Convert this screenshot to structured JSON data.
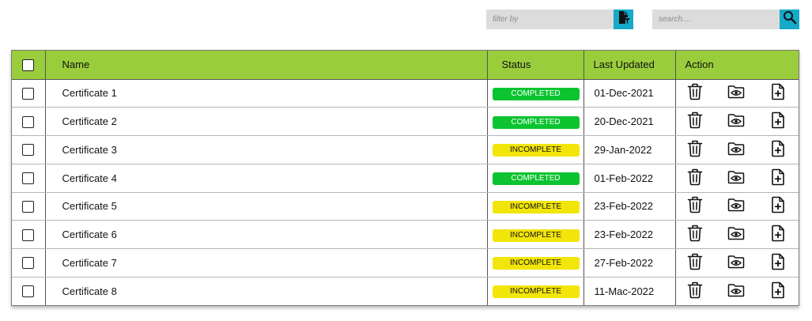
{
  "toolbar": {
    "filter_placeholder": "filter by",
    "search_placeholder": "search....",
    "accent_color": "#16a9c9"
  },
  "table": {
    "header_color": "#9acd3c",
    "columns": {
      "name": "Name",
      "status": "Status",
      "last_updated": "Last Updated",
      "action": "Action"
    },
    "status_colors": {
      "COMPLETED": "#0bc42f",
      "INCOMPLETE": "#f2e50b"
    },
    "rows": [
      {
        "name": "Certificate 1",
        "status": "COMPLETED",
        "date": "01-Dec-2021"
      },
      {
        "name": "Certificate 2",
        "status": "COMPLETED",
        "date": "20-Dec-2021"
      },
      {
        "name": "Certificate 3",
        "status": "INCOMPLETE",
        "date": "29-Jan-2022"
      },
      {
        "name": "Certificate 4",
        "status": "COMPLETED",
        "date": "01-Feb-2022"
      },
      {
        "name": "Certificate 5",
        "status": "INCOMPLETE",
        "date": "23-Feb-2022"
      },
      {
        "name": "Certificate 6",
        "status": "INCOMPLETE",
        "date": "23-Feb-2022"
      },
      {
        "name": "Certificate 7",
        "status": "INCOMPLETE",
        "date": "27-Feb-2022"
      },
      {
        "name": "Certificate 8",
        "status": "INCOMPLETE",
        "date": "11-Mac-2022"
      }
    ],
    "action_icons": [
      "trash-icon",
      "folder-eye-icon",
      "file-plus-icon"
    ]
  }
}
